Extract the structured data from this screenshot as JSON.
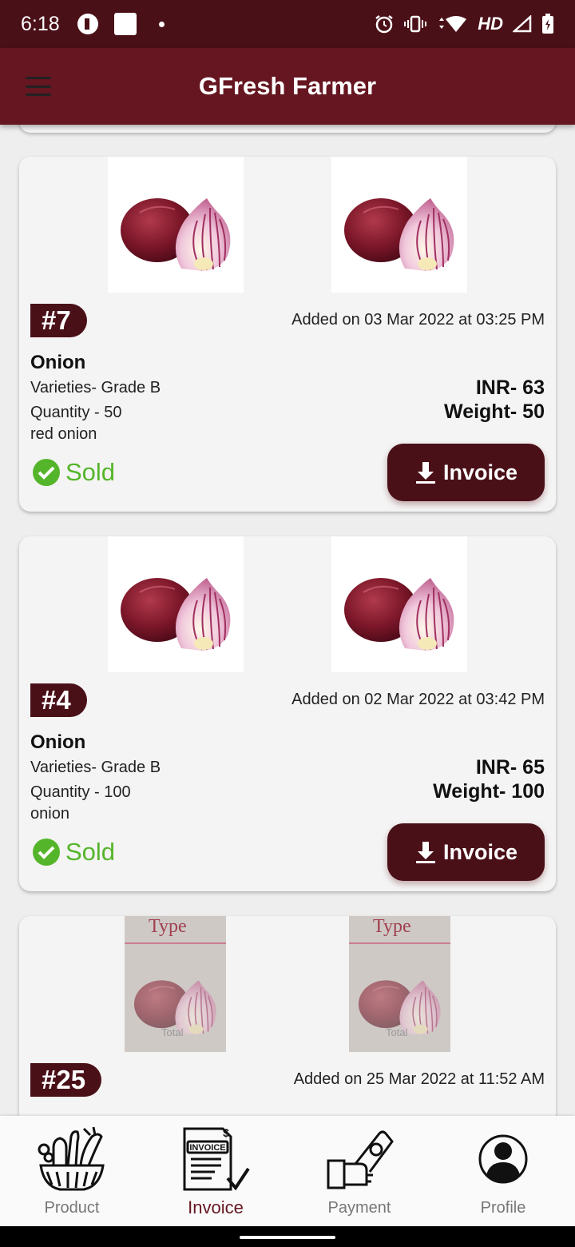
{
  "status_bar": {
    "time": "6:18",
    "network_label": "HD",
    "icons": [
      "app-notification-icon",
      "square-notification-icon",
      "dot-icon",
      "alarm-icon",
      "vibrate-icon",
      "wifi-icon",
      "signal-icon",
      "battery-icon"
    ]
  },
  "app_bar": {
    "title": "GFresh Farmer",
    "menu_icon": "hamburger-menu-icon"
  },
  "products": [
    {
      "id": "#7",
      "added": "Added on 03 Mar 2022 at 03:25 PM",
      "name": "Onion",
      "variety": "Varieties- Grade B",
      "quantity": "Quantity - 50",
      "description": "red onion",
      "price": "INR- 63",
      "weight": "Weight- 50",
      "status": "Sold",
      "invoice_label": "Invoice"
    },
    {
      "id": "#4",
      "added": "Added on 02 Mar 2022 at 03:42 PM",
      "name": "Onion",
      "variety": "Varieties- Grade B",
      "quantity": "Quantity - 100",
      "description": "onion",
      "price": "INR- 65",
      "weight": "Weight- 100",
      "status": "Sold",
      "invoice_label": "Invoice"
    },
    {
      "id": "#25",
      "added": "Added on 25 Mar 2022 at 11:52 AM",
      "photo_text": "Type",
      "photo_subtext": "Total"
    }
  ],
  "bottom_nav": [
    {
      "label": "Product",
      "icon": "vegetable-basket-icon",
      "active": false
    },
    {
      "label": "Invoice",
      "icon": "invoice-document-icon",
      "active": true
    },
    {
      "label": "Payment",
      "icon": "payment-hand-icon",
      "active": false
    },
    {
      "label": "Profile",
      "icon": "profile-user-icon",
      "active": false
    }
  ],
  "colors": {
    "status_bar": "#4a1018",
    "app_bar": "#651620",
    "accent": "#4a1018",
    "sold": "#55b52a",
    "active_nav": "#651620"
  }
}
